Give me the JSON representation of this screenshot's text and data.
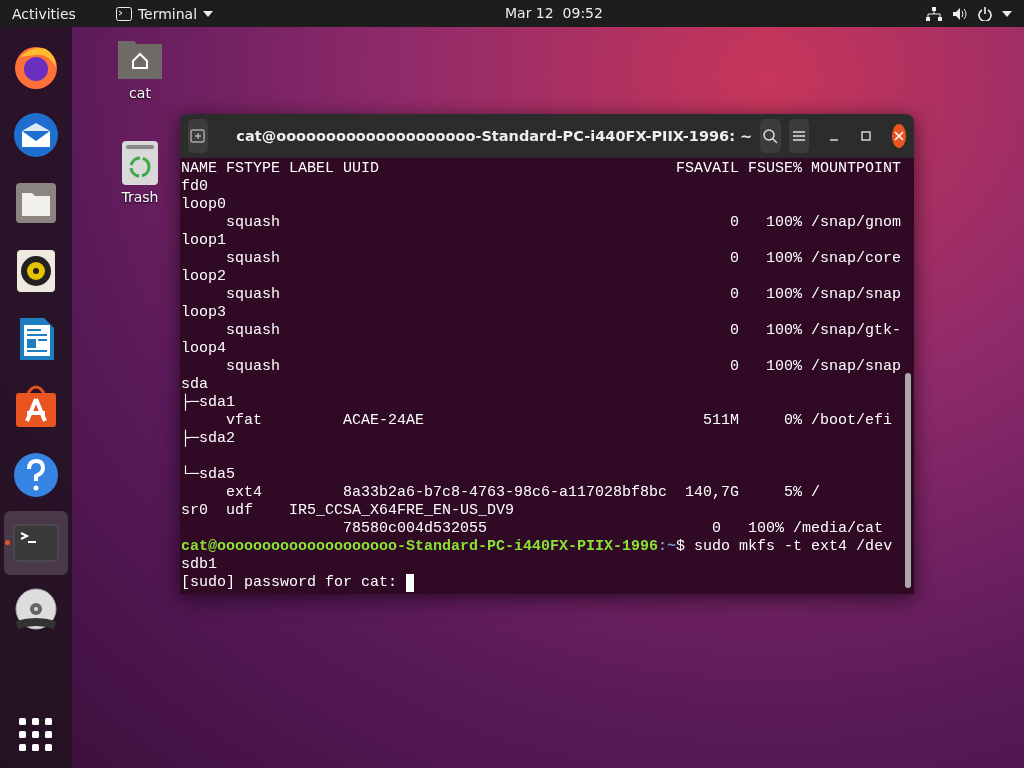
{
  "top_bar": {
    "activities": "Activities",
    "app_menu": "Terminal",
    "clock": "Mar 12  09:52"
  },
  "dock": {
    "items": [
      {
        "kind": "firefox",
        "selected": false,
        "running": false
      },
      {
        "kind": "mail",
        "selected": false,
        "running": false
      },
      {
        "kind": "files",
        "selected": false,
        "running": false
      },
      {
        "kind": "music",
        "selected": false,
        "running": false
      },
      {
        "kind": "writer",
        "selected": false,
        "running": false
      },
      {
        "kind": "store",
        "selected": false,
        "running": false
      },
      {
        "kind": "help",
        "selected": false,
        "running": false
      },
      {
        "kind": "terminal",
        "selected": true,
        "running": true
      },
      {
        "kind": "dvd",
        "selected": false,
        "running": false
      }
    ]
  },
  "desktop_icons": [
    {
      "kind": "home",
      "label": "cat"
    },
    {
      "kind": "trash",
      "label": "Trash"
    }
  ],
  "terminal": {
    "title": "cat@oooooooooooooooooooo-Standard-PC-i440FX-PIIX-1996: ~",
    "lines": [
      {
        "kind": "text",
        "text": "NAME FSTYPE LABEL UUID                                 FSAVAIL FSUSE% MOUNTPOINT"
      },
      {
        "kind": "text",
        "text": "fd0"
      },
      {
        "kind": "text",
        "text": "loop0"
      },
      {
        "kind": "text",
        "text": "     squash                                                  0   100% /snap/gnom"
      },
      {
        "kind": "text",
        "text": "loop1"
      },
      {
        "kind": "text",
        "text": "     squash                                                  0   100% /snap/core"
      },
      {
        "kind": "text",
        "text": "loop2"
      },
      {
        "kind": "text",
        "text": "     squash                                                  0   100% /snap/snap"
      },
      {
        "kind": "text",
        "text": "loop3"
      },
      {
        "kind": "text",
        "text": "     squash                                                  0   100% /snap/gtk-"
      },
      {
        "kind": "text",
        "text": "loop4"
      },
      {
        "kind": "text",
        "text": "     squash                                                  0   100% /snap/snap"
      },
      {
        "kind": "text",
        "text": "sda"
      },
      {
        "kind": "text",
        "text": "├─sda1"
      },
      {
        "kind": "text",
        "text": "     vfat         ACAE-24AE                               511M     0% /boot/efi"
      },
      {
        "kind": "text",
        "text": "├─sda2"
      },
      {
        "kind": "blank"
      },
      {
        "kind": "text",
        "text": "└─sda5"
      },
      {
        "kind": "text",
        "text": "     ext4         8a33b2a6-b7c8-4763-98c6-a117028bf8bc  140,7G     5% /"
      },
      {
        "kind": "text",
        "text": "sr0  udf    IR5_CCSA_X64FRE_EN-US_DV9"
      },
      {
        "kind": "text",
        "text": "                  78580c004d532055                         0   100% /media/cat"
      },
      {
        "kind": "prompt",
        "user_host": "cat@oooooooooooooooooooo-Standard-PC-i440FX-PIIX-1996",
        "path": ":~",
        "command": "$ sudo mkfs -t ext4 /dev"
      },
      {
        "kind": "text",
        "text": "sdb1"
      },
      {
        "kind": "input",
        "text": "[sudo] password for cat: ",
        "cursor": true
      }
    ]
  }
}
